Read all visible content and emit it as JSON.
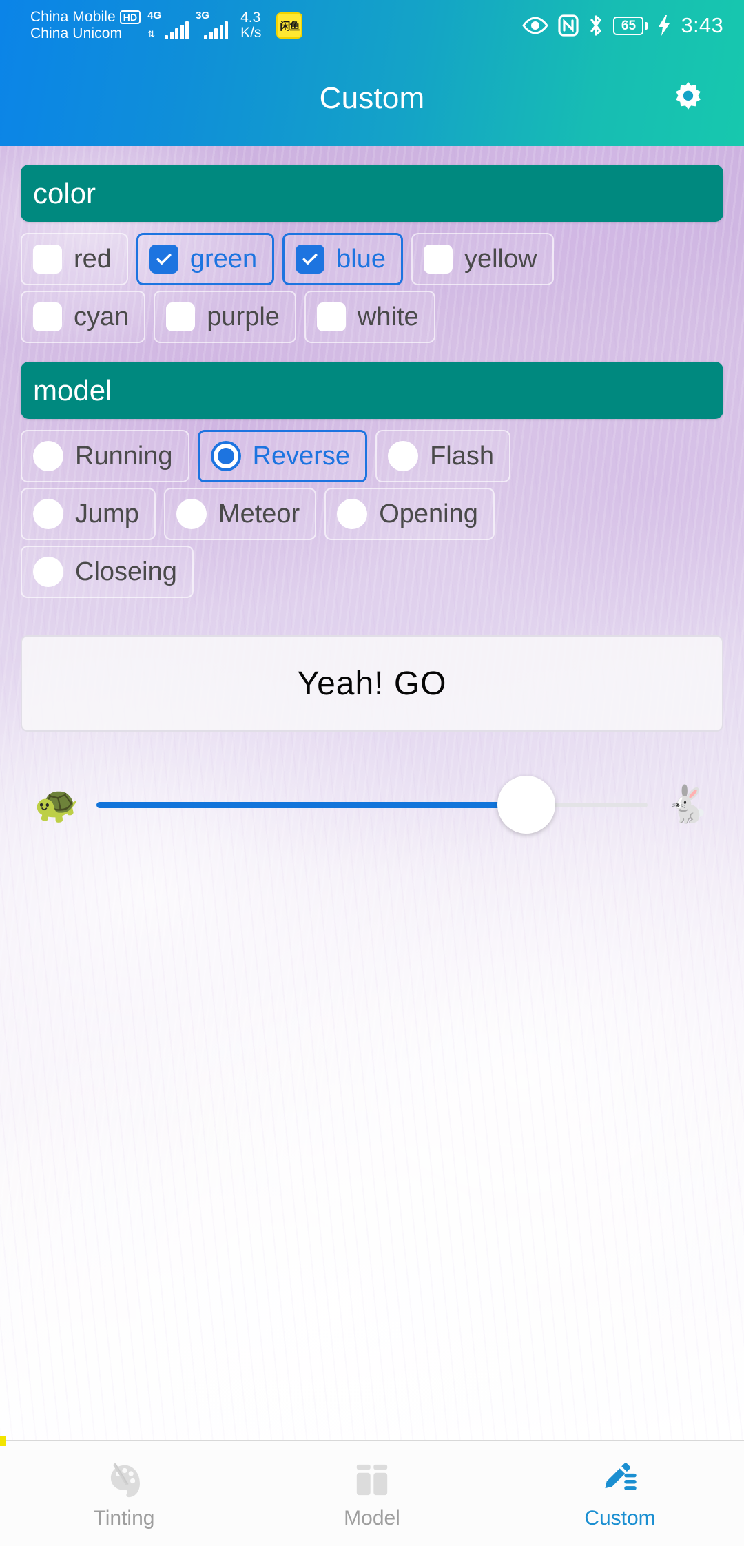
{
  "status_bar": {
    "carrier_1": "China Mobile",
    "carrier_1_badge": "HD",
    "carrier_2": "China Unicom",
    "signal_1_label": "4G",
    "signal_2_label": "3G",
    "net_speed_value": "4.3",
    "net_speed_unit": "K/s",
    "app_badge_text": "闲鱼",
    "battery_percent": "65",
    "time": "3:43",
    "icons": [
      "eye-care-icon",
      "nfc-icon",
      "bluetooth-icon",
      "battery-icon",
      "charging-bolt-icon"
    ]
  },
  "app_bar": {
    "title": "Custom",
    "settings_icon": "gear-icon"
  },
  "color_section": {
    "header": "color",
    "options": [
      {
        "label": "red",
        "checked": false
      },
      {
        "label": "green",
        "checked": true
      },
      {
        "label": "blue",
        "checked": true
      },
      {
        "label": "yellow",
        "checked": false
      },
      {
        "label": "cyan",
        "checked": false
      },
      {
        "label": "purple",
        "checked": false
      },
      {
        "label": "white",
        "checked": false
      }
    ]
  },
  "model_section": {
    "header": "model",
    "options": [
      {
        "label": "Running",
        "selected": false
      },
      {
        "label": "Reverse",
        "selected": true
      },
      {
        "label": "Flash",
        "selected": false
      },
      {
        "label": "Jump",
        "selected": false
      },
      {
        "label": "Meteor",
        "selected": false
      },
      {
        "label": "Opening",
        "selected": false
      },
      {
        "label": "Closeing",
        "selected": false
      }
    ]
  },
  "go_button": {
    "label": "Yeah!  GO"
  },
  "speed_slider": {
    "slow_icon": "🐢",
    "fast_icon": "🐇",
    "value_percent": 78
  },
  "bottom_nav": {
    "items": [
      {
        "label": "Tinting",
        "icon": "palette-brush-icon",
        "active": false
      },
      {
        "label": "Model",
        "icon": "layout-blocks-icon",
        "active": false
      },
      {
        "label": "Custom",
        "icon": "pen-list-icon",
        "active": true
      }
    ]
  },
  "colors": {
    "accent_blue": "#1d74e0",
    "section_teal": "#00897f",
    "nav_active": "#1b8fd1",
    "slider_fill": "#1274da"
  }
}
